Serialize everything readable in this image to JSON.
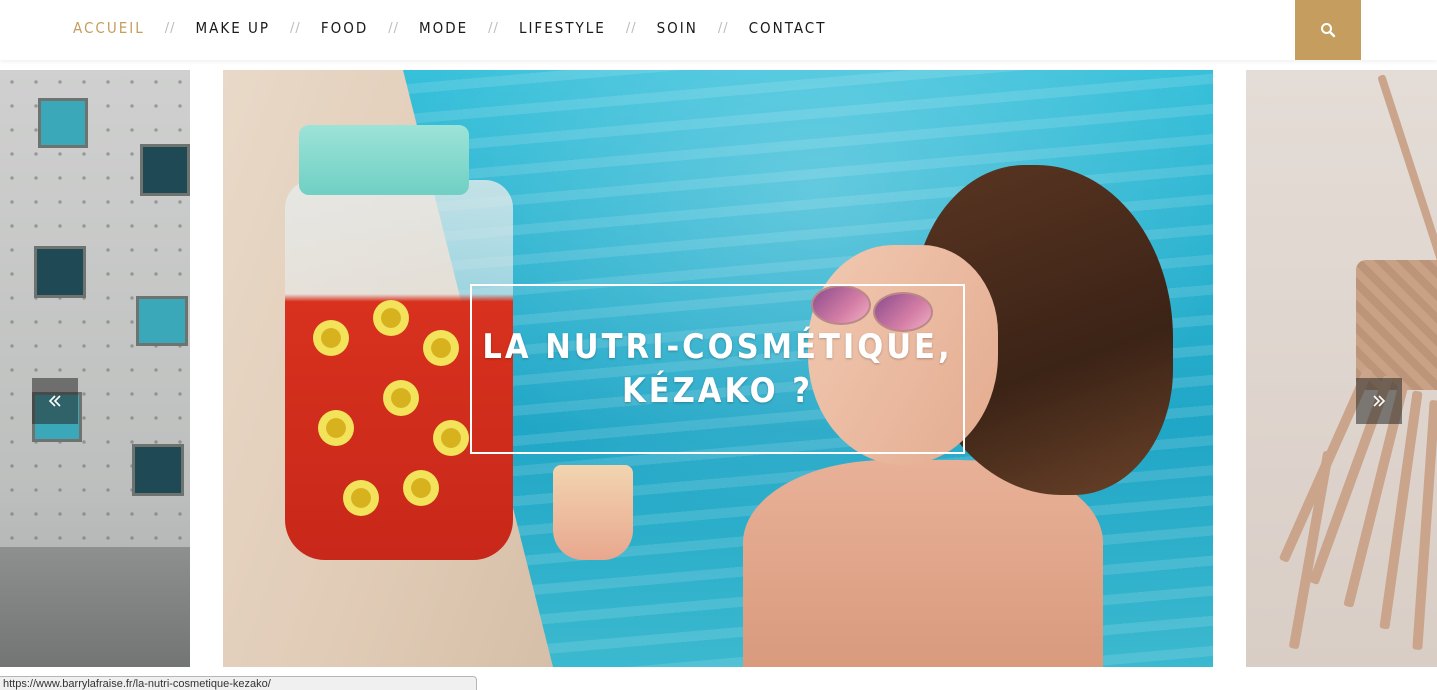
{
  "nav": {
    "items": [
      {
        "label": "ACCUEIL",
        "active": true
      },
      {
        "label": "MAKE UP"
      },
      {
        "label": "FOOD"
      },
      {
        "label": "MODE"
      },
      {
        "label": "LIFESTYLE"
      },
      {
        "label": "SOIN"
      },
      {
        "label": "CONTACT"
      }
    ],
    "separator": "//",
    "search_icon": "search-icon"
  },
  "slider": {
    "title_line1": "LA NUTRI-COSMÉTIQUE,",
    "title_line2": "KÉZAKO ?",
    "prev_icon": "double-chevron-left-icon",
    "next_icon": "double-chevron-right-icon"
  },
  "status_bar": {
    "url": "https://www.barrylafraise.fr/la-nutri-cosmetique-kezako/"
  },
  "colors": {
    "accent": "#c59d5f",
    "nav_text": "#1a1a1a",
    "separator": "#bcbcbc"
  }
}
